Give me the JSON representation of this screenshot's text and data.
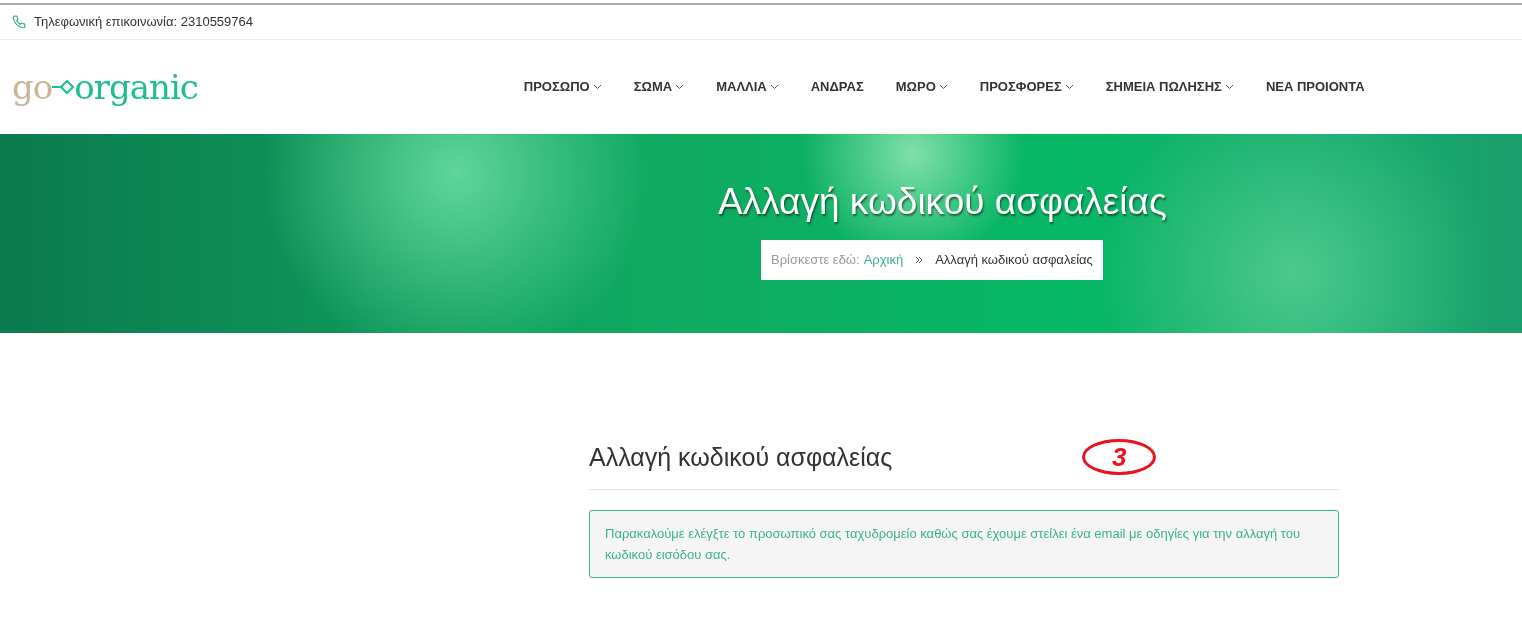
{
  "topbar": {
    "phone": "Τηλεφωνική επικοινωνία: 2310559764"
  },
  "logo": {
    "part_1": "go",
    "part_2": "organic"
  },
  "nav": [
    {
      "label": "ΠΡΟΣΩΠΟ",
      "has_dropdown": true
    },
    {
      "label": "ΣΩΜΑ",
      "has_dropdown": true
    },
    {
      "label": "ΜΑΛΛΙΑ",
      "has_dropdown": true
    },
    {
      "label": "ΑΝΔΡΑΣ",
      "has_dropdown": false
    },
    {
      "label": "ΜΩΡΟ",
      "has_dropdown": true
    },
    {
      "label": "ΠΡΟΣΦΟΡΕΣ",
      "has_dropdown": true
    },
    {
      "label": "ΣΗΜΕΙΑ ΠΩΛΗΣΗΣ",
      "has_dropdown": true
    },
    {
      "label": "ΝΕΑ ΠΡΟΙΟΝΤΑ",
      "has_dropdown": false
    }
  ],
  "hero": {
    "title": "Αλλαγή κωδικού ασφαλείας",
    "breadcrumb": {
      "prefix": "Βρίσκεστε εδώ:",
      "items": [
        {
          "label": "Αρχική",
          "kind": "link"
        },
        {
          "label": "Αλλαγή κωδικού ασφαλείας",
          "kind": "current"
        }
      ]
    }
  },
  "content": {
    "heading": "Αλλαγή κωδικού ασφαλείας",
    "annotation": "3",
    "alert": "Παρακαλούμε ελέγξτε το προσωπικό σας ταχυδρομείο καθώς σας έχουμε στείλει ένα email με οδηγίες για την αλλαγή του κωδικού εισόδου σας."
  }
}
